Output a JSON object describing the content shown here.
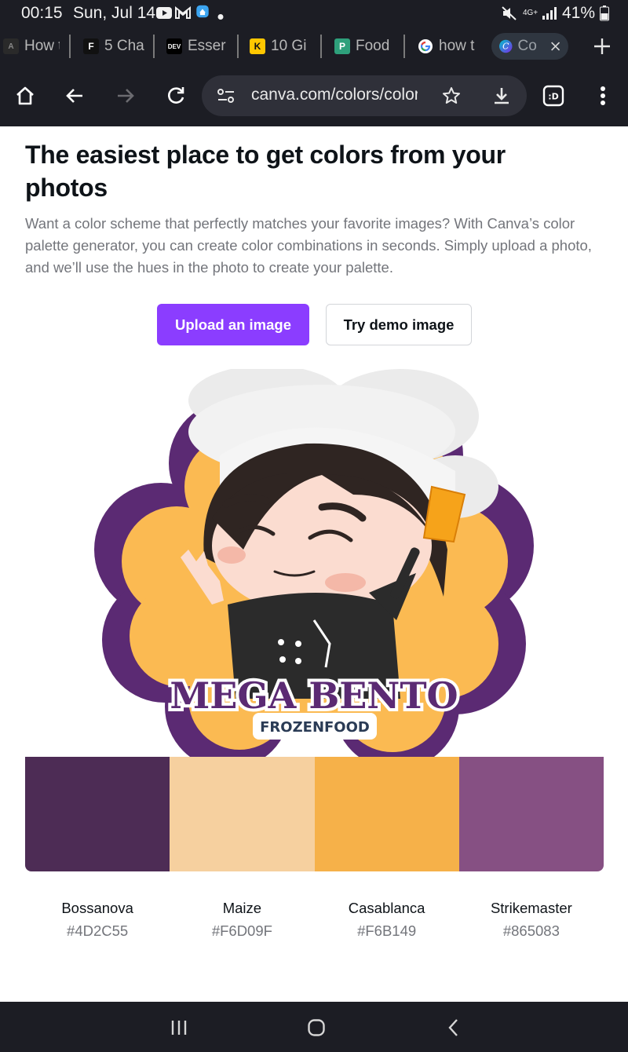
{
  "status_bar": {
    "time": "00:15",
    "date": "Sun, Jul 14",
    "battery": "41%",
    "network": "4G+"
  },
  "tabs": [
    {
      "label": "How t",
      "icon": "unknown-favicon"
    },
    {
      "label": "5 Cha",
      "icon": "F",
      "favicon_bg": "#111111",
      "favicon_fg": "#ffffff"
    },
    {
      "label": "Esser",
      "icon": "DEV",
      "favicon_bg": "#000000",
      "favicon_fg": "#ffffff"
    },
    {
      "label": "10 Gi",
      "icon": "K",
      "favicon_bg": "#ffc700",
      "favicon_fg": "#111111"
    },
    {
      "label": "Food",
      "icon": "P",
      "favicon_bg": "#2ea07b",
      "favicon_fg": "#ffffff"
    },
    {
      "label": "how t",
      "icon": "google-icon"
    },
    {
      "label": "Co",
      "icon": "canva-icon",
      "active": true
    }
  ],
  "toolbar": {
    "url": "canva.com/colors/color-palette-generator/"
  },
  "content": {
    "heading": "The easiest place to get colors from your photos",
    "intro": "Want a color scheme that perfectly matches your favorite images? With Canva’s color palette generator, you can create color combinations in seconds. Simply upload a photo, and we’ll use the hues in the photo to create your palette.",
    "upload_button": "Upload an image",
    "demo_button": "Try demo image"
  },
  "logo": {
    "title": "MEGA BENTO",
    "subtitle": "FROZENFOOD"
  },
  "palette": [
    {
      "name": "Bossanova",
      "hex": "#4D2C55"
    },
    {
      "name": "Maize",
      "hex": "#F6D09F"
    },
    {
      "name": "Casablanca",
      "hex": "#F6B149"
    },
    {
      "name": "Strikemaster",
      "hex": "#865083"
    }
  ],
  "colors": {
    "accent": "#8B3DFF",
    "chrome": "#1C1D24"
  }
}
